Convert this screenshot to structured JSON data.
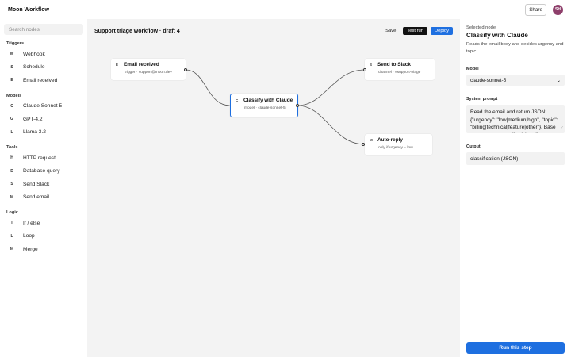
{
  "app": {
    "title": "Moon Workflow"
  },
  "header": {
    "share_label": "Share",
    "avatar_initials": "SH",
    "avatar_color": "#8e3f6b"
  },
  "sidebar": {
    "search_placeholder": "Search nodes",
    "groups": [
      {
        "title": "Triggers",
        "items": [
          {
            "letter": "W",
            "label": "Webhook"
          },
          {
            "letter": "S",
            "label": "Schedule"
          },
          {
            "letter": "E",
            "label": "Email received"
          }
        ]
      },
      {
        "title": "Models",
        "items": [
          {
            "letter": "C",
            "label": "Claude Sonnet 5"
          },
          {
            "letter": "G",
            "label": "GPT-4.2"
          },
          {
            "letter": "L",
            "label": "Llama 3.2"
          }
        ]
      },
      {
        "title": "Tools",
        "items": [
          {
            "letter": "H",
            "label": "HTTP request"
          },
          {
            "letter": "D",
            "label": "Database query"
          },
          {
            "letter": "S",
            "label": "Send Slack"
          },
          {
            "letter": "M",
            "label": "Send email"
          }
        ]
      },
      {
        "title": "Logic",
        "items": [
          {
            "letter": "I",
            "label": "If / else"
          },
          {
            "letter": "L",
            "label": "Loop"
          },
          {
            "letter": "M",
            "label": "Merge"
          }
        ]
      }
    ]
  },
  "canvas": {
    "workflow_title": "Support triage workflow · draft 4",
    "save_label": "Save",
    "test_run_label": "Test run",
    "deploy_label": "Deploy",
    "accent_color": "#1e6fe0",
    "nodes": {
      "email": {
        "letter": "E",
        "title": "Email received",
        "subtitle": "trigger · support@moon.dev"
      },
      "classify": {
        "letter": "C",
        "title": "Classify with Claude",
        "subtitle": "model · claude-sonnet-5"
      },
      "slack": {
        "letter": "S",
        "title": "Send to Slack",
        "subtitle": "channel · #support-triage"
      },
      "reply": {
        "letter": "M",
        "title": "Auto-reply",
        "subtitle": "only if urgency = low"
      }
    }
  },
  "panel": {
    "selected_label": "Selected node",
    "title": "Classify with Claude",
    "description": "Reads the email body and decides urgency and topic.",
    "model_label": "Model",
    "model_value": "claude-sonnet-5",
    "prompt_label": "System prompt",
    "prompt_value": "Read the email and return JSON: {\"urgency\": \"low|medium|high\", \"topic\": \"billing|technical|feature|other\"}. Base urgency on words like \"down\", \"broken\".",
    "output_label": "Output",
    "output_value": "classification (JSON)",
    "run_label": "Run this step"
  }
}
